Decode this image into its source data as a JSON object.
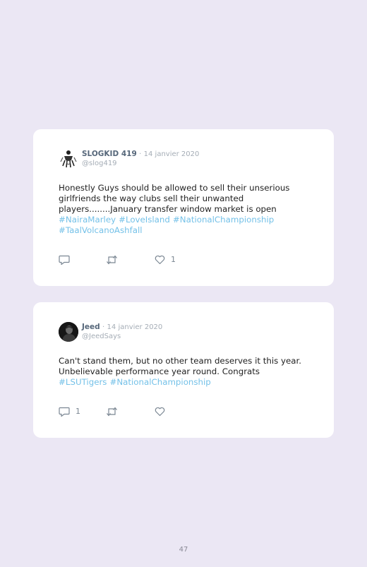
{
  "tweets": [
    {
      "author": "SLOGKID 419",
      "separator": "·",
      "date": "14 janvier 2020",
      "handle": "@slog419",
      "text_lines": [
        "Honestly Guys should be allowed to sell their unserious",
        "girlfriends the way clubs sell their unwanted",
        "players........January transfer window market is open"
      ],
      "hashtags": [
        "#NairaMarley",
        "#LoveIsland",
        "#NationalChampionship",
        "#TaalVolcanoAshfall"
      ],
      "reply_count": "",
      "retweet_count": "",
      "like_count": "1"
    },
    {
      "author": "Jeed",
      "separator": "·",
      "date": "14 janvier 2020",
      "handle": "@JeedSays",
      "text_lines": [
        "Can't stand them, but no other team deserves it this year.",
        "Unbelievable performance year round. Congrats"
      ],
      "hashtags": [
        "#LSUTigers",
        "#NationalChampionship"
      ],
      "reply_count": "1",
      "retweet_count": "",
      "like_count": ""
    }
  ],
  "page_number": "47",
  "colors": {
    "background": "#ebe7f4",
    "card": "#ffffff",
    "hashtag": "#74c1e8",
    "author": "#56677a",
    "muted": "#a5adb6"
  }
}
